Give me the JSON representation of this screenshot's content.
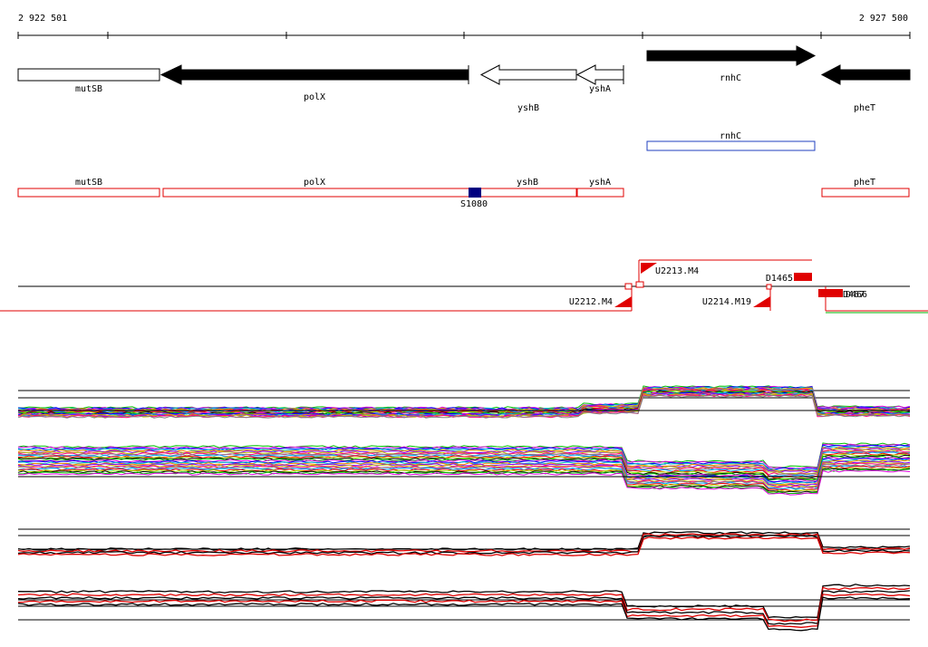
{
  "ruler": {
    "start_label": "2 922 501",
    "end_label": "2 927 500"
  },
  "gene_track": {
    "genes": [
      {
        "label": "mutSB",
        "strand": "+",
        "style": "open-box"
      },
      {
        "label": "polX",
        "strand": "-",
        "style": "filled-arrow"
      },
      {
        "label": "yshB",
        "strand": "-",
        "style": "open-arrow"
      },
      {
        "label": "yshA",
        "strand": "-",
        "style": "open-arrow"
      },
      {
        "label": "rnhC",
        "strand": "+",
        "style": "filled-arrow"
      },
      {
        "label": "pheT",
        "strand": "-",
        "style": "filled-arrow"
      }
    ]
  },
  "annotation_track": {
    "label": "rnhC",
    "color": "#1f3fbf"
  },
  "region_track": {
    "color": "#e00000",
    "regions": [
      {
        "label": "mutSB"
      },
      {
        "label": "polX"
      },
      {
        "label": "yshB"
      },
      {
        "label": "yshA"
      },
      {
        "label": "pheT"
      }
    ],
    "marker": {
      "label": "S1080",
      "color": "#000080"
    }
  },
  "feature_track": {
    "color": "#e00000",
    "features": [
      {
        "label": "U2213.M4"
      },
      {
        "label": "D1465"
      },
      {
        "label": "U2212.M4"
      },
      {
        "label": "U2214.M19"
      },
      {
        "label": "D467"
      },
      {
        "label": "D466"
      }
    ]
  },
  "profile_colors": [
    "#00c000",
    "#e000e0",
    "#0000ff",
    "#00c0c0",
    "#ff8000",
    "#8000ff",
    "#c0c000",
    "#ff0080",
    "#808080",
    "#00a0ff",
    "#ff0000",
    "#a0e000"
  ]
}
